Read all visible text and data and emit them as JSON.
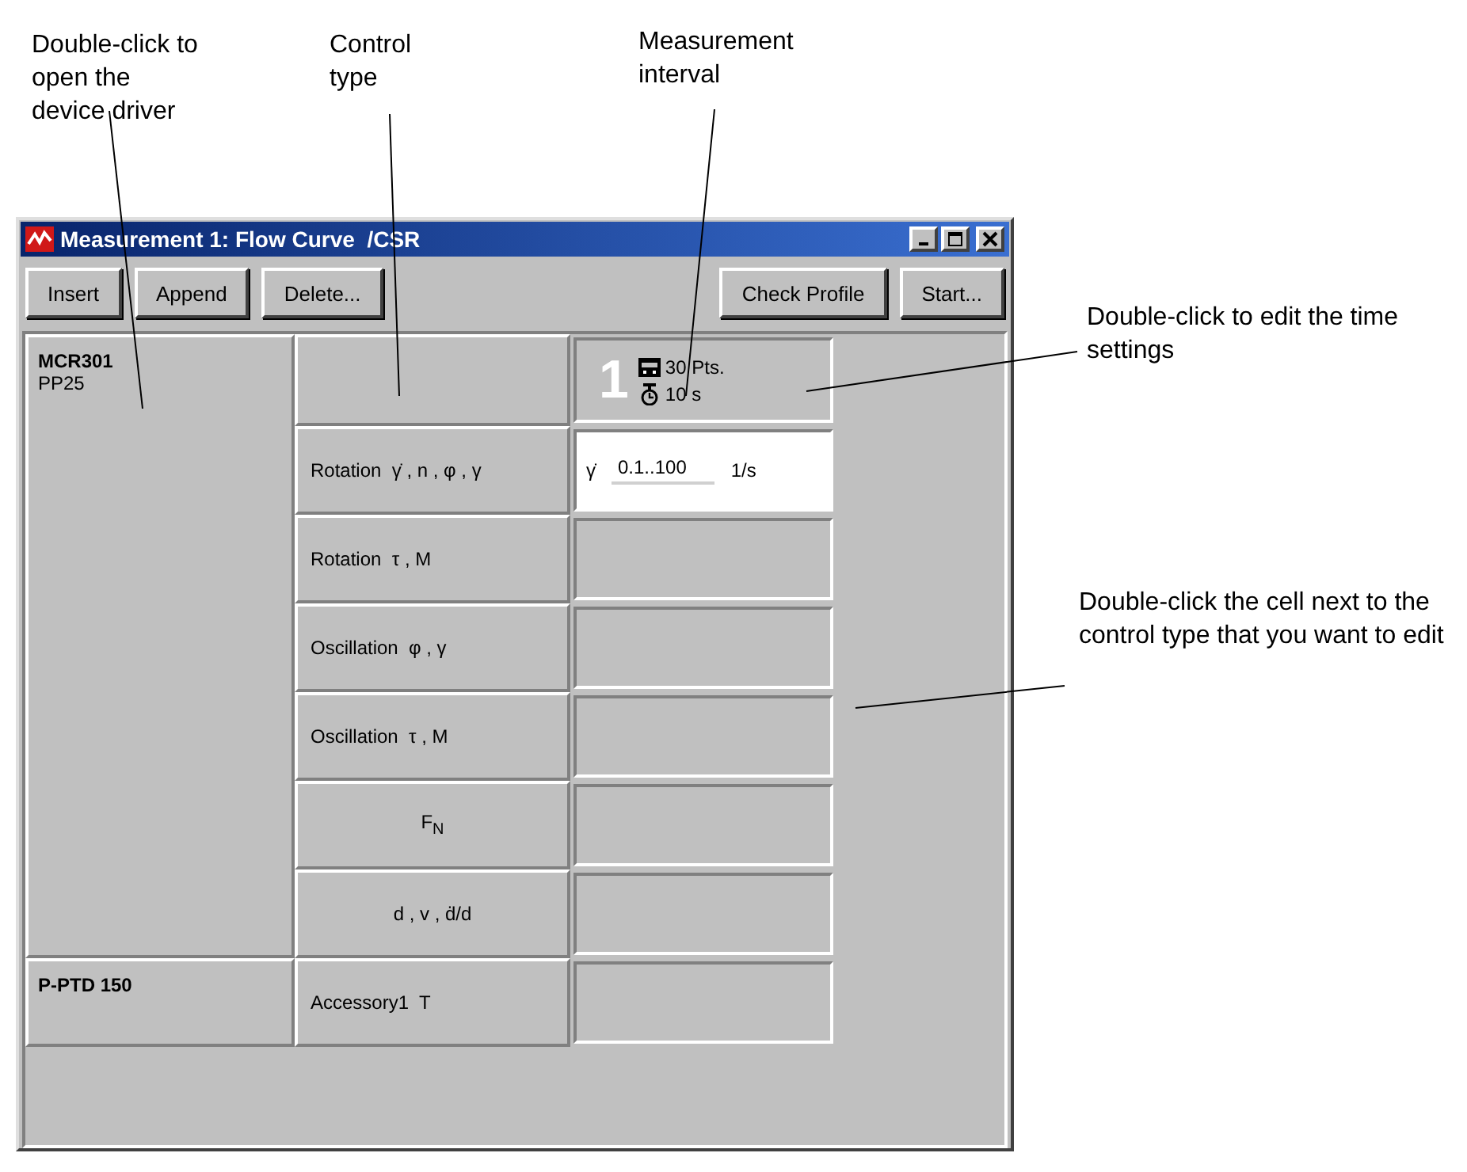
{
  "annotations": [
    {
      "text": "Double-click to open the device driver"
    },
    {
      "text": "Control type"
    },
    {
      "text": "Measurement interval"
    },
    {
      "text": "Double-click to edit the time settings"
    },
    {
      "text": "Double-click the cell next to the control type that you want to edit"
    }
  ],
  "window": {
    "title": "Measurement 1: Flow Curve  /CSR"
  },
  "toolbar": {
    "left_buttons": [
      "Insert",
      "Append",
      "Delete..."
    ],
    "right_buttons": [
      "Check Profile",
      "Start..."
    ]
  },
  "interval": {
    "number": "1",
    "points": "30 Pts.",
    "time": "10 s"
  },
  "devices": [
    {
      "name": "MCR301",
      "detail": "PP25",
      "controls": [
        {
          "label": "Rotation  γ̇ , n , φ , γ",
          "value": {
            "symbol": "γ̇",
            "range": "0.1..100",
            "unit": "1/s"
          }
        },
        {
          "label": "Rotation  τ , M"
        },
        {
          "label": "Oscillation  φ , γ"
        },
        {
          "label": "Oscillation  τ , M"
        },
        {
          "label": "F$_{N}$"
        },
        {
          "label": "d , v , ḋ/d"
        }
      ]
    },
    {
      "name": "P-PTD 150",
      "controls": [
        {
          "label": "Accessory1  T"
        }
      ]
    }
  ]
}
